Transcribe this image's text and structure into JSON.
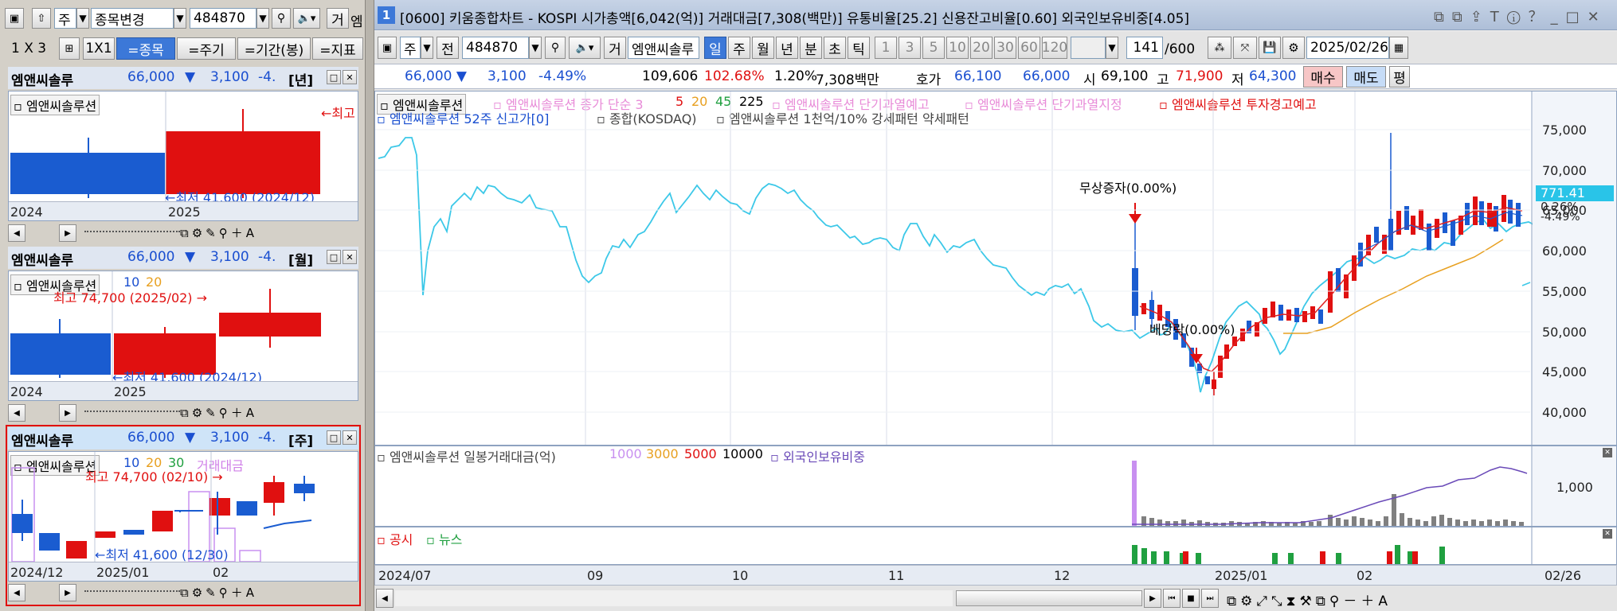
{
  "left": {
    "toolbar": {
      "market": "주",
      "code_change": "종목변경",
      "code": "484870",
      "mode_label": "거",
      "mode_extra": "엠"
    },
    "layout": {
      "grid_label": "1 X 3",
      "one_by_one": "1X1",
      "stock_btn": "=종목",
      "period_btn": "=주기",
      "range_btn": "=기간(봉)",
      "indicator_btn": "=지표"
    },
    "panels": [
      {
        "name": "엠앤씨솔루",
        "price": "66,000",
        "change": "3,100",
        "pct": "-4.",
        "period": "[년]",
        "legend_title": "엠앤씨솔루션",
        "legend_ma": [],
        "high_label": "←최고",
        "low_label": "←최저 41,600 (2024/12)",
        "dates": [
          "2024",
          "2025"
        ]
      },
      {
        "name": "엠앤씨솔루",
        "price": "66,000",
        "change": "3,100",
        "pct": "-4.",
        "period": "[월]",
        "legend_title": "엠앤씨솔루션",
        "legend_ma": [
          "10",
          "20"
        ],
        "high_label": "최고 74,700 (2025/02) →",
        "low_label": "←최저 41,600 (2024/12)",
        "dates": [
          "2024",
          "2025"
        ]
      },
      {
        "name": "엠앤씨솔루",
        "price": "66,000",
        "change": "3,100",
        "pct": "-4.",
        "period": "[주]",
        "legend_title": "엠앤씨솔루션",
        "legend_ma": [
          "10",
          "20",
          "30"
        ],
        "legend_extra": "거래대금",
        "high_label": "최고 74,700 (02/10) →",
        "low_label": "←최저 41,600 (12/30)",
        "dates": [
          "2024/12",
          "2025/01",
          "02"
        ]
      }
    ]
  },
  "main": {
    "title_num": "1",
    "title": "[0600] 키움종합차트 - KOSPI 시가총액[6,042(억)] 거래대금[7,308(백만)] 유통비율[25.2] 신용잔고비율[0.60] 외국인보유비중[4.05]",
    "toolbar": {
      "market": "주",
      "prev": "전",
      "code": "484870",
      "mode": "거",
      "name": "엠앤씨솔루",
      "periods": [
        "일",
        "주",
        "월",
        "년",
        "분",
        "초",
        "틱"
      ],
      "active_period": "일",
      "nums": [
        "1",
        "3",
        "5",
        "10",
        "20",
        "30",
        "60",
        "120"
      ],
      "count": "141",
      "total": "/600",
      "date": "2025/02/26"
    },
    "quote": {
      "price": "66,000 ▼",
      "change": "3,100",
      "pct": "-4.49%",
      "volume": "109,606",
      "vol_ratio": "102.68%",
      "turnover": "1.20%",
      "amount": "7,308백만",
      "ask_label": "호가",
      "ask": "66,100",
      "bid": "66,000",
      "open_label": "시",
      "open": "69,100",
      "high_label": "고",
      "high": "71,900",
      "low_label": "저",
      "low": "64,300",
      "buy": "매수",
      "sell": "매도",
      "flat": "평"
    },
    "legend1": {
      "name": "엠앤씨솔루션",
      "close_label": "엠앤씨솔루션 종가 단순 3",
      "ma": [
        "5",
        "20",
        "45",
        "225"
      ],
      "warn1": "엠앤씨솔루션 단기과열예고",
      "warn2": "엠앤씨솔루션 단기과열지정",
      "warn3": "엠앤씨솔루션 투자경고예고"
    },
    "legend2": {
      "high52": "엠앤씨솔루션 52주 신고가[0]",
      "index": "종합(KOSDAQ)",
      "pattern": "엠앤씨솔루션 1천억/10% 강세패턴  약세패턴"
    },
    "annotations": {
      "bonus": "무상증자(0.00%)",
      "dividend": "배당락(0.00%)"
    },
    "yaxis": [
      "75,000",
      "70,000",
      "65,000",
      "60,000",
      "55,000",
      "50,000",
      "45,000",
      "40,000"
    ],
    "current_price_tag": "771.41",
    "current_pct_tag": "0.26%",
    "current_pct_tag2": "-4.49%",
    "legend_vol": {
      "title": "엠앤씨솔루션 일봉거래대금(억)",
      "levels": [
        "1000",
        "3000",
        "5000",
        "10000"
      ],
      "foreign": "외국인보유비중"
    },
    "vol_axis": "1,000",
    "legend_news": {
      "notice": "공시",
      "news": "뉴스"
    },
    "xaxis": [
      "2024/07",
      "09",
      "10",
      "11",
      "12",
      "2025/01",
      "02",
      "02/26"
    ]
  },
  "colors": {
    "up": "#e01010",
    "down": "#1a5cd0",
    "index_line": "#3cc8e8",
    "ma_red": "#e02020",
    "ma_orange": "#e8a020",
    "foreign_line": "#6a4ab8",
    "volume_bar": "#808080"
  }
}
